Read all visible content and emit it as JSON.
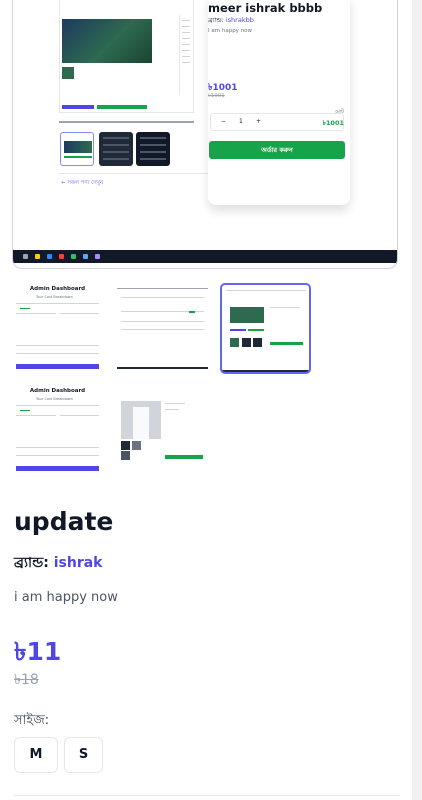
{
  "main_image": {
    "product_title": "meer ishrak bbbb",
    "brand_label": "ব্র্যান্ড:",
    "brand_value": "ishrakbb",
    "description": "I am happy now",
    "price": "৳1001",
    "old_price": "৳1001",
    "qty_minus": "−",
    "qty_value": "1",
    "qty_plus": "+",
    "total_label": "মোট",
    "total_value": "৳1001",
    "order_button": "অর্ডার করুন",
    "back_link": "← সকল পণ্য দেখুন"
  },
  "gallery": {
    "thumb1_title": "Admin Dashboard",
    "thumb1_subtitle": "Tour Cost Breakdown",
    "thumb4_title": "Admin Dashboard",
    "thumb4_subtitle": "Tour Cost Breakdown"
  },
  "product": {
    "title": "update",
    "brand_label": "ব্র্যান্ড: ",
    "brand_value": "ishrak",
    "description": "i am happy now",
    "price": "৳11",
    "old_price": "৳18",
    "size_label": "সাইজ:",
    "sizes": [
      "M",
      "S"
    ]
  },
  "colors": {
    "accent": "#4f46e5",
    "order_green": "#16a34a",
    "active_border": "#6366f1"
  }
}
